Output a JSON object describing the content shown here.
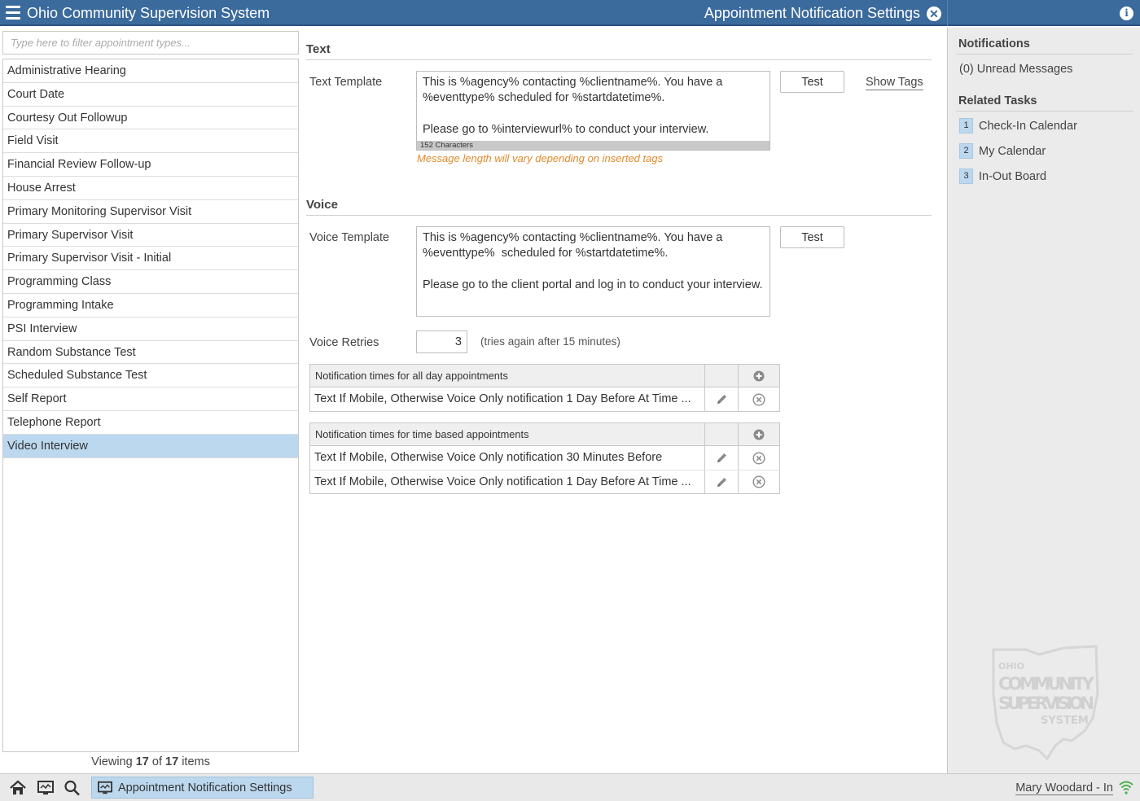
{
  "header": {
    "app_title": "Ohio Community Supervision System",
    "page_title": "Appointment Notification Settings",
    "close_glyph": "✕",
    "info_glyph": "i"
  },
  "left": {
    "filter_placeholder": "Type here to filter appointment types...",
    "items": [
      "Administrative Hearing",
      "Court Date",
      "Courtesy Out Followup",
      "Field Visit",
      "Financial Review Follow-up",
      "House Arrest",
      "Primary Monitoring Supervisor Visit",
      "Primary Supervisor Visit",
      "Primary Supervisor Visit - Initial",
      "Programming Class",
      "Programming Intake",
      "PSI Interview",
      "Random Substance Test",
      "Scheduled Substance Test",
      "Self Report",
      "Telephone Report",
      "Video Interview"
    ],
    "selected_index": 16,
    "viewing": {
      "prefix": "Viewing",
      "shown": "17",
      "of": "of",
      "total": "17",
      "suffix": "items"
    }
  },
  "text_section": {
    "heading": "Text",
    "label": "Text Template",
    "template": "This is %agency% contacting %clientname%. You have a %eventtype% scheduled for %startdatetime%.\n\nPlease go to %interviewurl% to conduct your interview.",
    "char_count": "152 Characters",
    "warning": "Message length will vary depending on inserted tags",
    "test_label": "Test",
    "show_tags_label": "Show Tags"
  },
  "voice_section": {
    "heading": "Voice",
    "label": "Voice Template",
    "template": "This is %agency% contacting %clientname%. You have a %eventtype%  scheduled for %startdatetime%.\n\nPlease go to the client portal and log in to conduct your interview.",
    "test_label": "Test",
    "retries_label": "Voice Retries",
    "retries_value": "3",
    "retries_hint": "(tries again after 15 minutes)"
  },
  "all_day_table": {
    "header": "Notification times for all day appointments",
    "rows": [
      "Text If Mobile, Otherwise Voice Only notification 1 Day Before At Time ..."
    ]
  },
  "time_based_table": {
    "header": "Notification times for time based appointments",
    "rows": [
      "Text If Mobile, Otherwise Voice Only notification 30 Minutes Before",
      "Text If Mobile, Otherwise Voice Only notification 1 Day Before At Time ..."
    ]
  },
  "right_panel": {
    "notifications_heading": "Notifications",
    "unread": "(0) Unread Messages",
    "related_heading": "Related Tasks",
    "tasks": [
      {
        "num": "1",
        "label": "Check-In Calendar"
      },
      {
        "num": "2",
        "label": "My Calendar"
      },
      {
        "num": "3",
        "label": "In-Out Board"
      }
    ],
    "watermark": {
      "line1": "OHIO",
      "line2": "COMMUNITY",
      "line3": "SUPERVISION",
      "line4": "SYSTEM"
    }
  },
  "taskbar": {
    "active_app": "Appointment Notification Settings",
    "user": "Mary Woodard - In"
  },
  "colors": {
    "header_bg": "#3b6a9c",
    "selected_bg": "#bcd8ef",
    "warning": "#e08a2c",
    "wifi": "#4caf50"
  },
  "icons": [
    "menu-icon",
    "close-icon",
    "info-icon",
    "pencil-icon",
    "remove-icon",
    "add-icon",
    "home-icon",
    "monitor-icon",
    "search-icon",
    "wifi-icon"
  ]
}
